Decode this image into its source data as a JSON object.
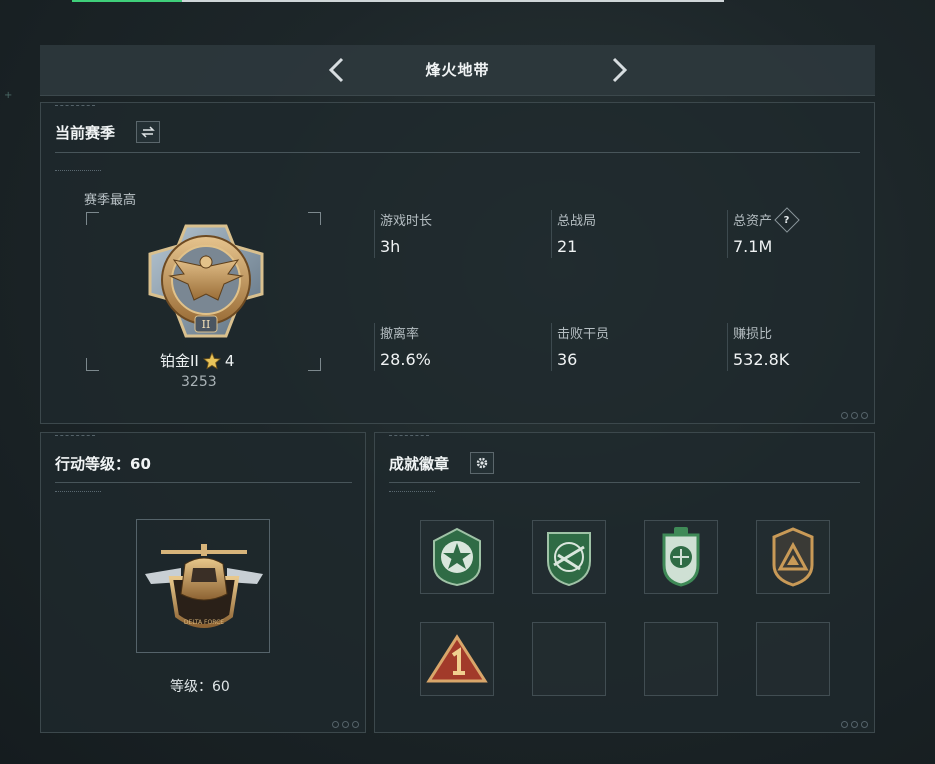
{
  "header": {
    "title": "烽火地带"
  },
  "season": {
    "title": "当前赛季",
    "best_label": "赛季最高",
    "rank_name": "铂金II",
    "rank_stars": "4",
    "rank_score": "3253",
    "stats": [
      {
        "label": "游戏时长",
        "value": "3h"
      },
      {
        "label": "总战局",
        "value": "21"
      },
      {
        "label": "总资产",
        "value": "7.1M"
      },
      {
        "label": "撤离率",
        "value": "28.6%"
      },
      {
        "label": "击败干员",
        "value": "36"
      },
      {
        "label": "赚损比",
        "value": "532.8K"
      }
    ],
    "help_glyph": "?"
  },
  "action_level": {
    "title": "行动等级：60",
    "level_text": "等级：60"
  },
  "achievements": {
    "title": "成就徽章",
    "badges": [
      {
        "icon": "green-star-badge-icon",
        "empty": false
      },
      {
        "icon": "green-rifle-badge-icon",
        "empty": false
      },
      {
        "icon": "green-shield-badge-icon",
        "empty": false
      },
      {
        "icon": "bronze-triangle-badge-icon",
        "empty": false
      },
      {
        "icon": "red-number-one-badge-icon",
        "empty": false
      },
      {
        "icon": "",
        "empty": true
      },
      {
        "icon": "",
        "empty": true
      },
      {
        "icon": "",
        "empty": true
      }
    ]
  },
  "colors": {
    "accent": "#3fcf7a",
    "gold": "#c99a57",
    "green_badge": "#2f6b45",
    "red_badge": "#a23a2a"
  }
}
